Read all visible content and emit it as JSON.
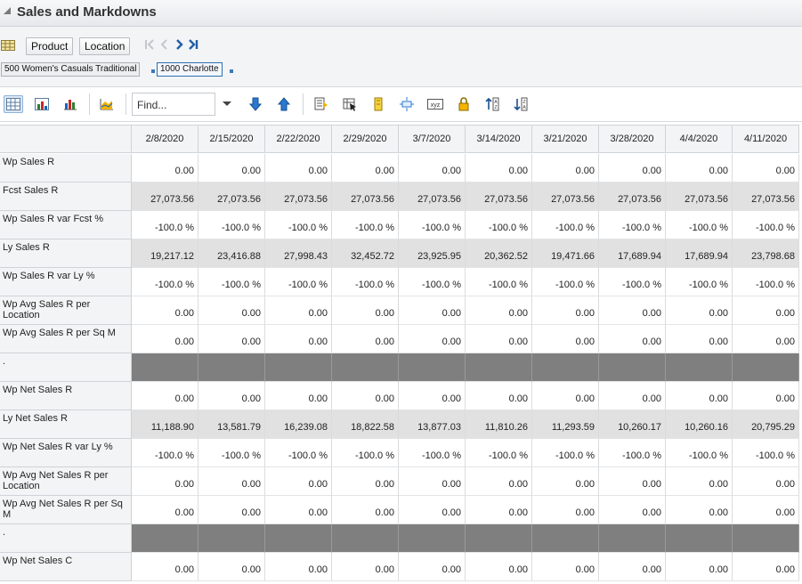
{
  "title": "Sales and Markdowns",
  "pov": {
    "dimensions": [
      "Product",
      "Location"
    ],
    "selections": [
      "500 Women's Casuals Traditional",
      "1000 Charlotte"
    ]
  },
  "toolbar": {
    "find_placeholder": "Find..."
  },
  "table": {
    "columns": [
      "2/8/2020",
      "2/15/2020",
      "2/22/2020",
      "2/29/2020",
      "3/7/2020",
      "3/14/2020",
      "3/21/2020",
      "3/28/2020",
      "4/4/2020",
      "4/11/2020"
    ],
    "rows": [
      {
        "label": "Wp Sales R",
        "style": "plain",
        "values": [
          "0.00",
          "0.00",
          "0.00",
          "0.00",
          "0.00",
          "0.00",
          "0.00",
          "0.00",
          "0.00",
          "0.00"
        ]
      },
      {
        "label": "Fcst Sales R",
        "style": "shade",
        "values": [
          "27,073.56",
          "27,073.56",
          "27,073.56",
          "27,073.56",
          "27,073.56",
          "27,073.56",
          "27,073.56",
          "27,073.56",
          "27,073.56",
          "27,073.56"
        ]
      },
      {
        "label": "Wp Sales R var Fcst %",
        "style": "plain",
        "values": [
          "-100.0 %",
          "-100.0 %",
          "-100.0 %",
          "-100.0 %",
          "-100.0 %",
          "-100.0 %",
          "-100.0 %",
          "-100.0 %",
          "-100.0 %",
          "-100.0 %"
        ]
      },
      {
        "label": "Ly Sales R",
        "style": "shade",
        "values": [
          "19,217.12",
          "23,416.88",
          "27,998.43",
          "32,452.72",
          "23,925.95",
          "20,362.52",
          "19,471.66",
          "17,689.94",
          "17,689.94",
          "23,798.68"
        ]
      },
      {
        "label": "Wp Sales R var Ly %",
        "style": "plain",
        "values": [
          "-100.0 %",
          "-100.0 %",
          "-100.0 %",
          "-100.0 %",
          "-100.0 %",
          "-100.0 %",
          "-100.0 %",
          "-100.0 %",
          "-100.0 %",
          "-100.0 %"
        ]
      },
      {
        "label": "Wp Avg Sales R per Location",
        "style": "plain",
        "values": [
          "0.00",
          "0.00",
          "0.00",
          "0.00",
          "0.00",
          "0.00",
          "0.00",
          "0.00",
          "0.00",
          "0.00"
        ]
      },
      {
        "label": "Wp Avg Sales R per Sq M",
        "style": "plain",
        "values": [
          "0.00",
          "0.00",
          "0.00",
          "0.00",
          "0.00",
          "0.00",
          "0.00",
          "0.00",
          "0.00",
          "0.00"
        ]
      },
      {
        "label": ".",
        "style": "sep",
        "values": [
          "",
          "",
          "",
          "",
          "",
          "",
          "",
          "",
          "",
          ""
        ]
      },
      {
        "label": "Wp Net Sales R",
        "style": "plain",
        "values": [
          "0.00",
          "0.00",
          "0.00",
          "0.00",
          "0.00",
          "0.00",
          "0.00",
          "0.00",
          "0.00",
          "0.00"
        ]
      },
      {
        "label": "Ly Net Sales R",
        "style": "shade",
        "values": [
          "11,188.90",
          "13,581.79",
          "16,239.08",
          "18,822.58",
          "13,877.03",
          "11,810.26",
          "11,293.59",
          "10,260.17",
          "10,260.16",
          "20,795.29"
        ]
      },
      {
        "label": "Wp Net Sales R var Ly %",
        "style": "plain",
        "values": [
          "-100.0 %",
          "-100.0 %",
          "-100.0 %",
          "-100.0 %",
          "-100.0 %",
          "-100.0 %",
          "-100.0 %",
          "-100.0 %",
          "-100.0 %",
          "-100.0 %"
        ]
      },
      {
        "label": "Wp Avg Net Sales R per Location",
        "style": "plain",
        "values": [
          "0.00",
          "0.00",
          "0.00",
          "0.00",
          "0.00",
          "0.00",
          "0.00",
          "0.00",
          "0.00",
          "0.00"
        ]
      },
      {
        "label": "Wp Avg Net Sales R per Sq M",
        "style": "plain",
        "values": [
          "0.00",
          "0.00",
          "0.00",
          "0.00",
          "0.00",
          "0.00",
          "0.00",
          "0.00",
          "0.00",
          "0.00"
        ]
      },
      {
        "label": ".",
        "style": "sep",
        "values": [
          "",
          "",
          "",
          "",
          "",
          "",
          "",
          "",
          "",
          ""
        ]
      },
      {
        "label": "Wp Net Sales C",
        "style": "plain",
        "values": [
          "0.00",
          "0.00",
          "0.00",
          "0.00",
          "0.00",
          "0.00",
          "0.00",
          "0.00",
          "0.00",
          "0.00"
        ]
      }
    ]
  },
  "colors": {
    "header_bg": "#f3f4f5",
    "shade_row": "#e1e1e1",
    "separator_row": "#7f7f7f",
    "accent": "#2a6fb0"
  }
}
